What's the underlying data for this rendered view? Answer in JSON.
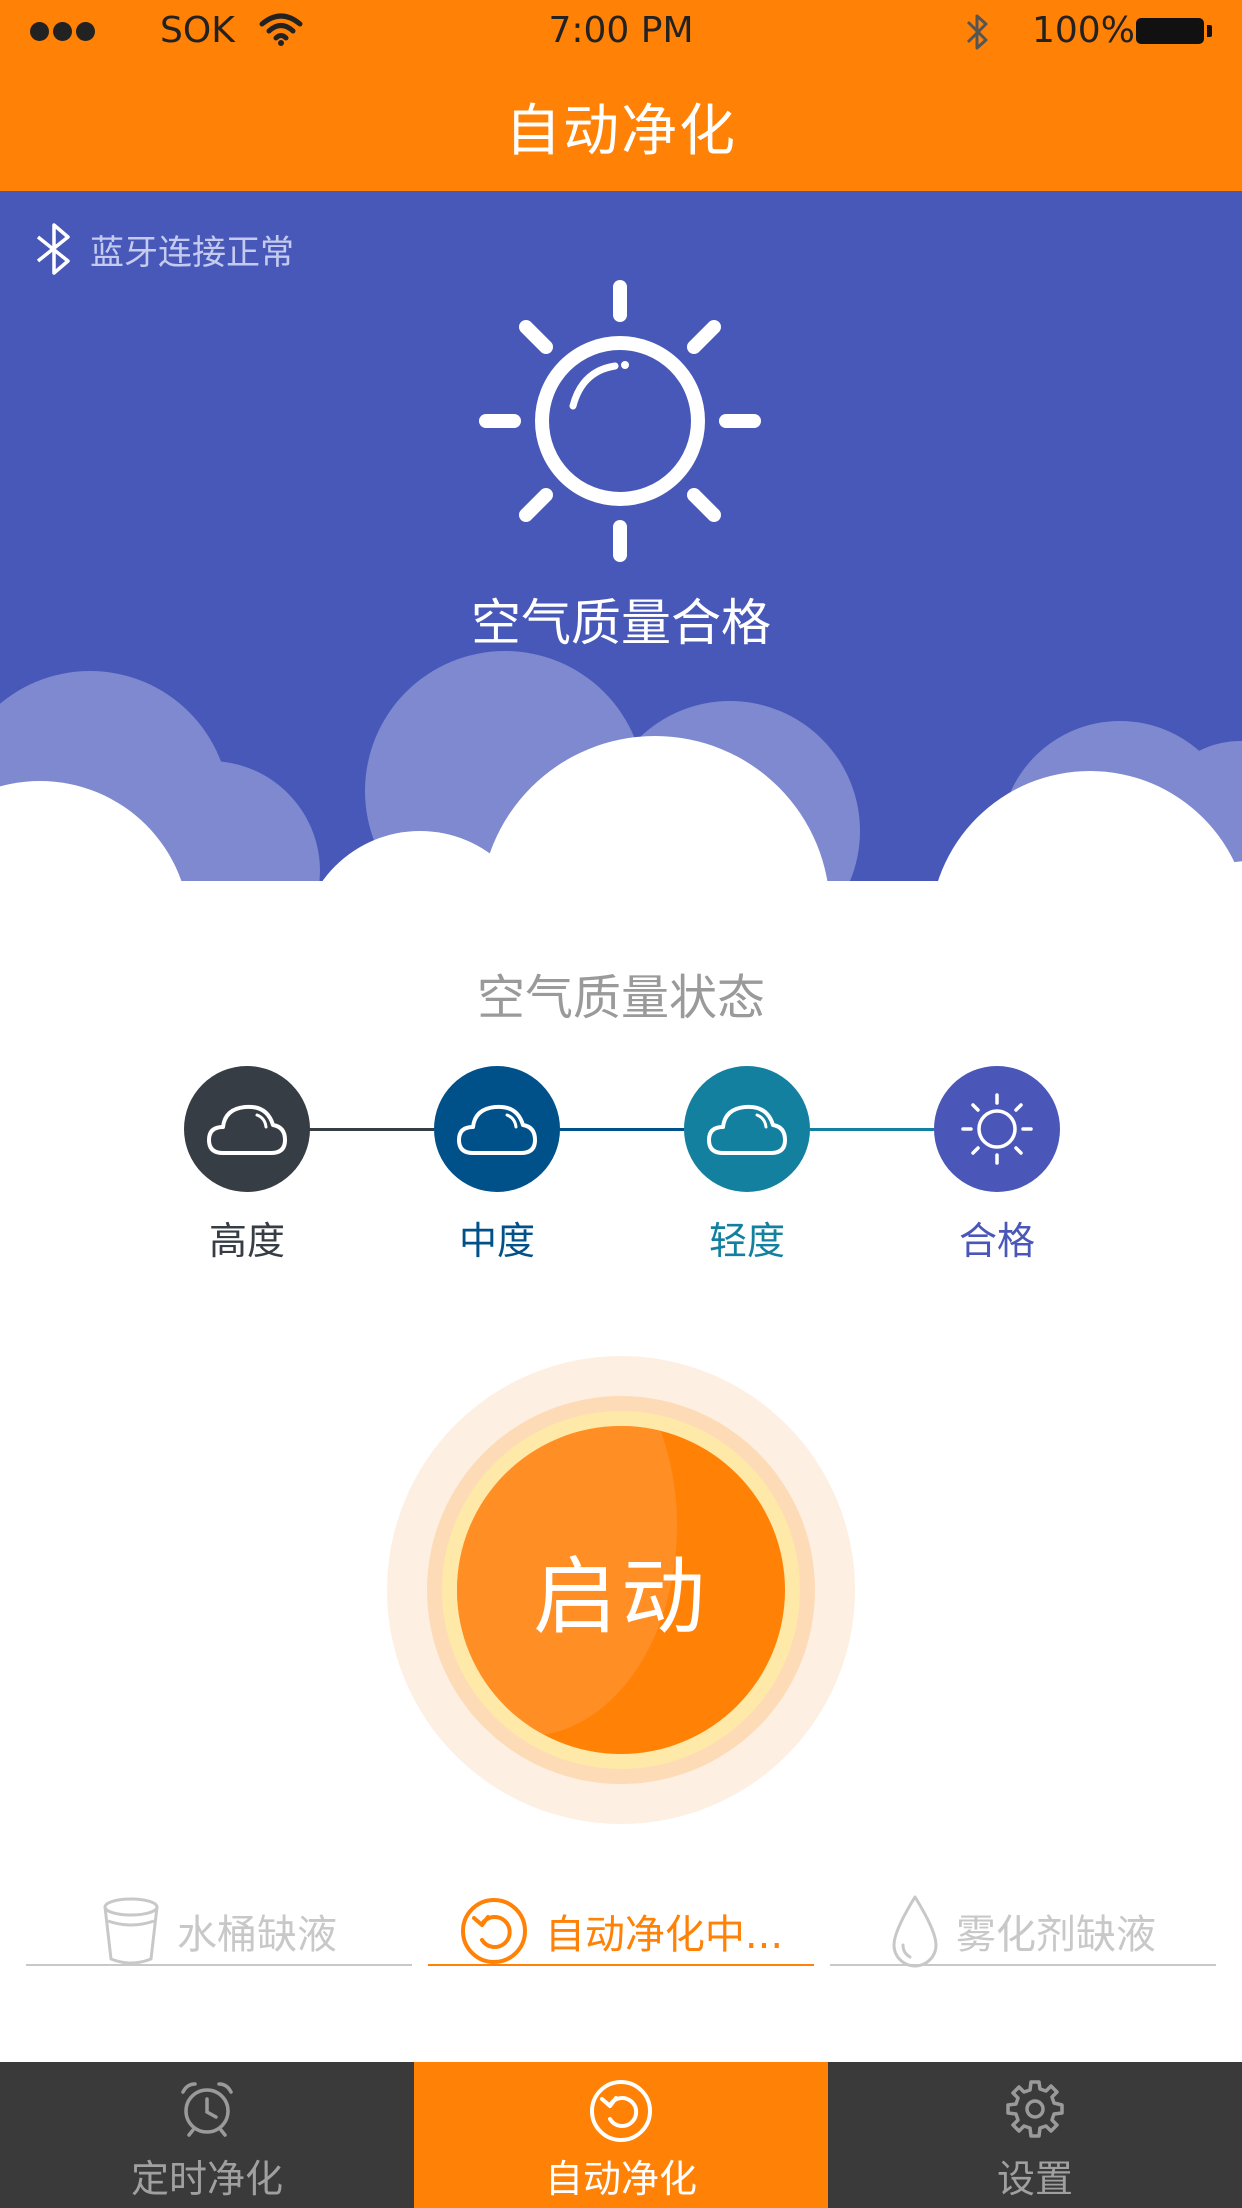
{
  "status_bar": {
    "carrier": "SOK",
    "time": "7:00 PM",
    "battery": "100%"
  },
  "header": {
    "title": "自动净化"
  },
  "hero": {
    "bluetooth_status": "蓝牙连接正常",
    "air_quality": "空气质量合格"
  },
  "quality_status": {
    "title": "空气质量状态",
    "levels": [
      {
        "label": "高度",
        "color": "#363d44",
        "icon": "cloud-icon"
      },
      {
        "label": "中度",
        "color": "#00508a",
        "icon": "cloud-icon"
      },
      {
        "label": "轻度",
        "color": "#1480a0",
        "icon": "cloud-icon"
      },
      {
        "label": "合格",
        "color": "#4a56b8",
        "icon": "sun-icon"
      }
    ]
  },
  "start_button": {
    "label": "启动"
  },
  "status_strip": {
    "items": [
      {
        "label": "水桶缺液",
        "icon": "bucket-icon",
        "color": "#c8c8c8",
        "active": false
      },
      {
        "label": "自动净化中...",
        "icon": "refresh-icon",
        "color": "#ff8106",
        "active": true
      },
      {
        "label": "雾化剂缺液",
        "icon": "droplet-icon",
        "color": "#c8c8c8",
        "active": false
      }
    ]
  },
  "tab_bar": {
    "tabs": [
      {
        "label": "定时净化",
        "icon": "alarm-clock-icon",
        "active": false
      },
      {
        "label": "自动净化",
        "icon": "refresh-icon",
        "active": true
      },
      {
        "label": "设置",
        "icon": "gear-icon",
        "active": false
      }
    ]
  },
  "colors": {
    "accent": "#ff8106",
    "hero_bg": "#4858b9",
    "tabbar_bg": "#3a3a3a",
    "inactive_text": "#c8c8c8"
  }
}
